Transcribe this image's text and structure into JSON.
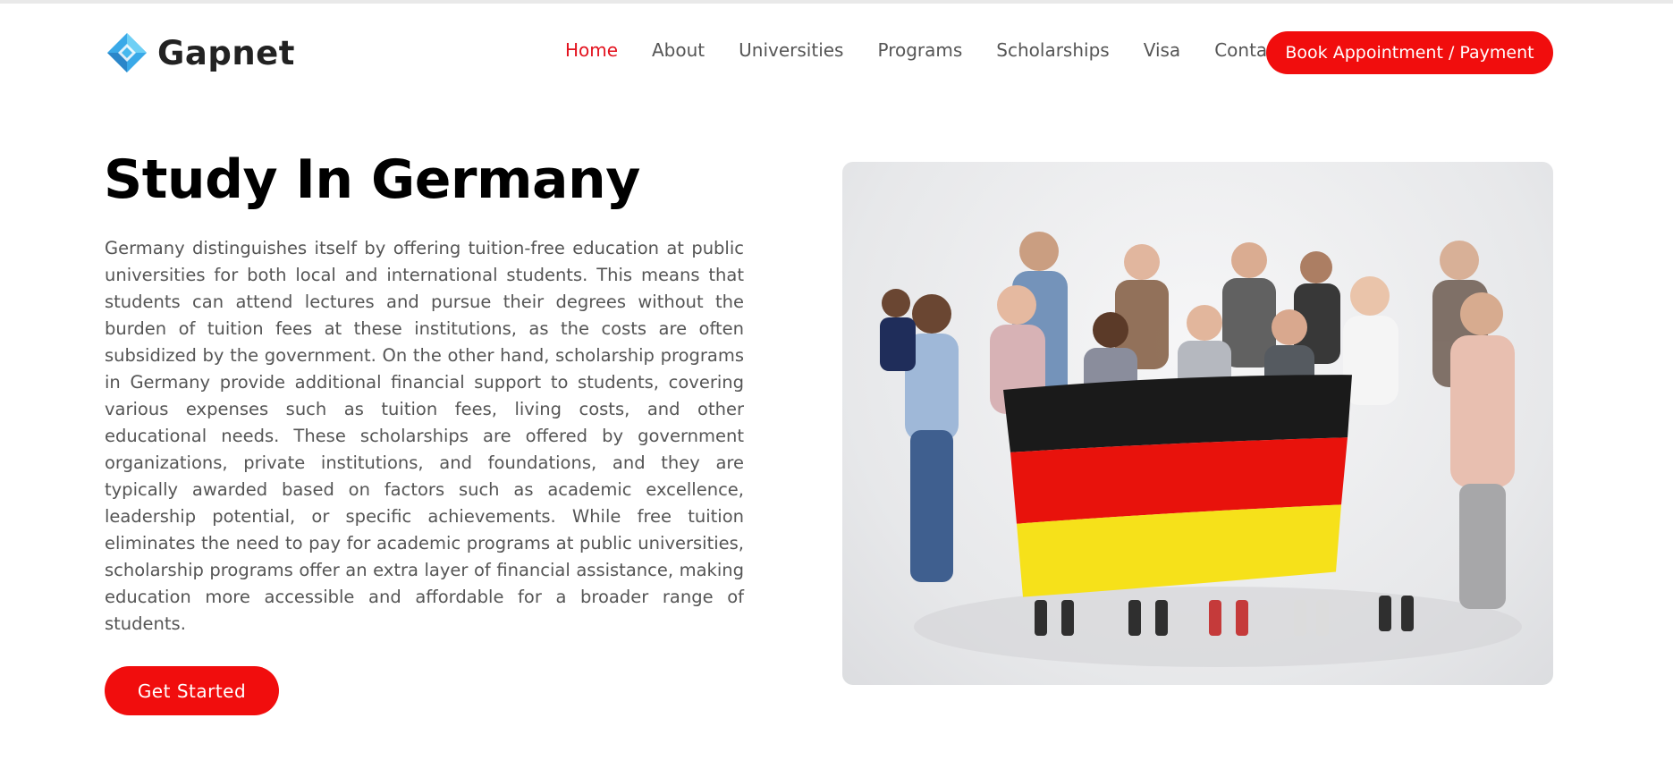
{
  "brand": {
    "name": "Gapnet"
  },
  "nav": {
    "items": [
      {
        "label": "Home",
        "active": true
      },
      {
        "label": "About"
      },
      {
        "label": "Universities"
      },
      {
        "label": "Programs"
      },
      {
        "label": "Scholarships"
      },
      {
        "label": "Visa"
      },
      {
        "label": "Contact"
      }
    ],
    "cta_label": "Book Appointment / Payment"
  },
  "hero": {
    "title": "Study In Germany",
    "paragraph": "Germany distinguishes itself by offering tuition-free education at public universities for both local and international students. This means that students can attend lectures and pursue their degrees without the burden of tuition fees at these institutions, as the costs are often subsidized by the government. On the other hand, scholarship programs in Germany provide additional financial support to students, covering various expenses such as tuition fees, living costs, and other educational needs. These scholarships are offered by government organizations, private institutions, and foundations, and they are typically awarded based on factors such as academic excellence, leadership potential, or specific achievements. While free tuition eliminates the need to pay for academic programs at public universities, scholarship programs offer an extra layer of financial assistance, making education more accessible and affordable for a broader range of students.",
    "cta_label": "Get Started"
  },
  "colors": {
    "accent": "#f10d0d",
    "nav_active": "#e3121e",
    "text": "#555555",
    "flag_black": "#1a1a1a",
    "flag_red": "#e8120c",
    "flag_gold": "#f6e11a"
  },
  "icons": {
    "logo": "gapnet-logo-icon"
  }
}
